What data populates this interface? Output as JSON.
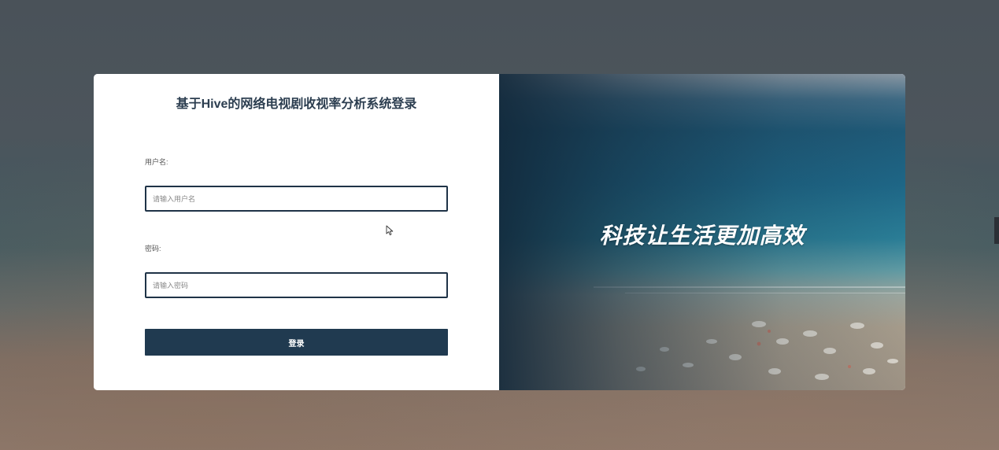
{
  "login": {
    "title": "基于Hive的网络电视剧收视率分析系统登录",
    "username_label": "用户名:",
    "username_placeholder": "请输入用户名",
    "username_value": "",
    "password_label": "密码:",
    "password_placeholder": "请输入密码",
    "password_value": "",
    "submit_label": "登录"
  },
  "banner": {
    "slogan": "科技让生活更加高效"
  },
  "colors": {
    "primary": "#203a50",
    "input_border": "#1f3347",
    "title_text": "#2c3e50"
  }
}
